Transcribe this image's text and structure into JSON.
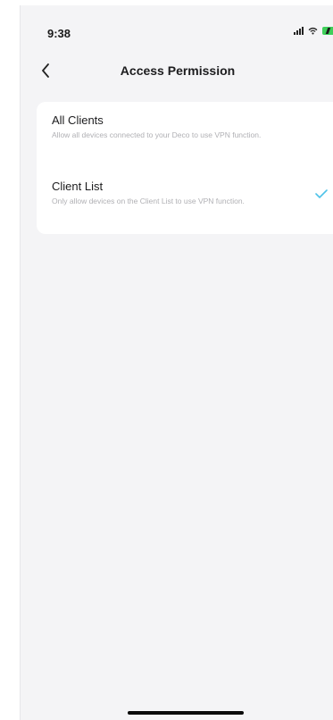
{
  "status_bar": {
    "time": "9:38"
  },
  "nav": {
    "title": "Access Permission",
    "back_icon": "chevron-left-icon"
  },
  "options": [
    {
      "title": "All Clients",
      "description": "Allow all devices connected to your Deco to use VPN function.",
      "selected": false
    },
    {
      "title": "Client List",
      "description": "Only allow devices on the Client List to use VPN function.",
      "selected": true
    }
  ],
  "colors": {
    "accent": "#4fc3e8",
    "background": "#f4f4f6",
    "card": "#ffffff",
    "battery": "#3fcf5a"
  }
}
